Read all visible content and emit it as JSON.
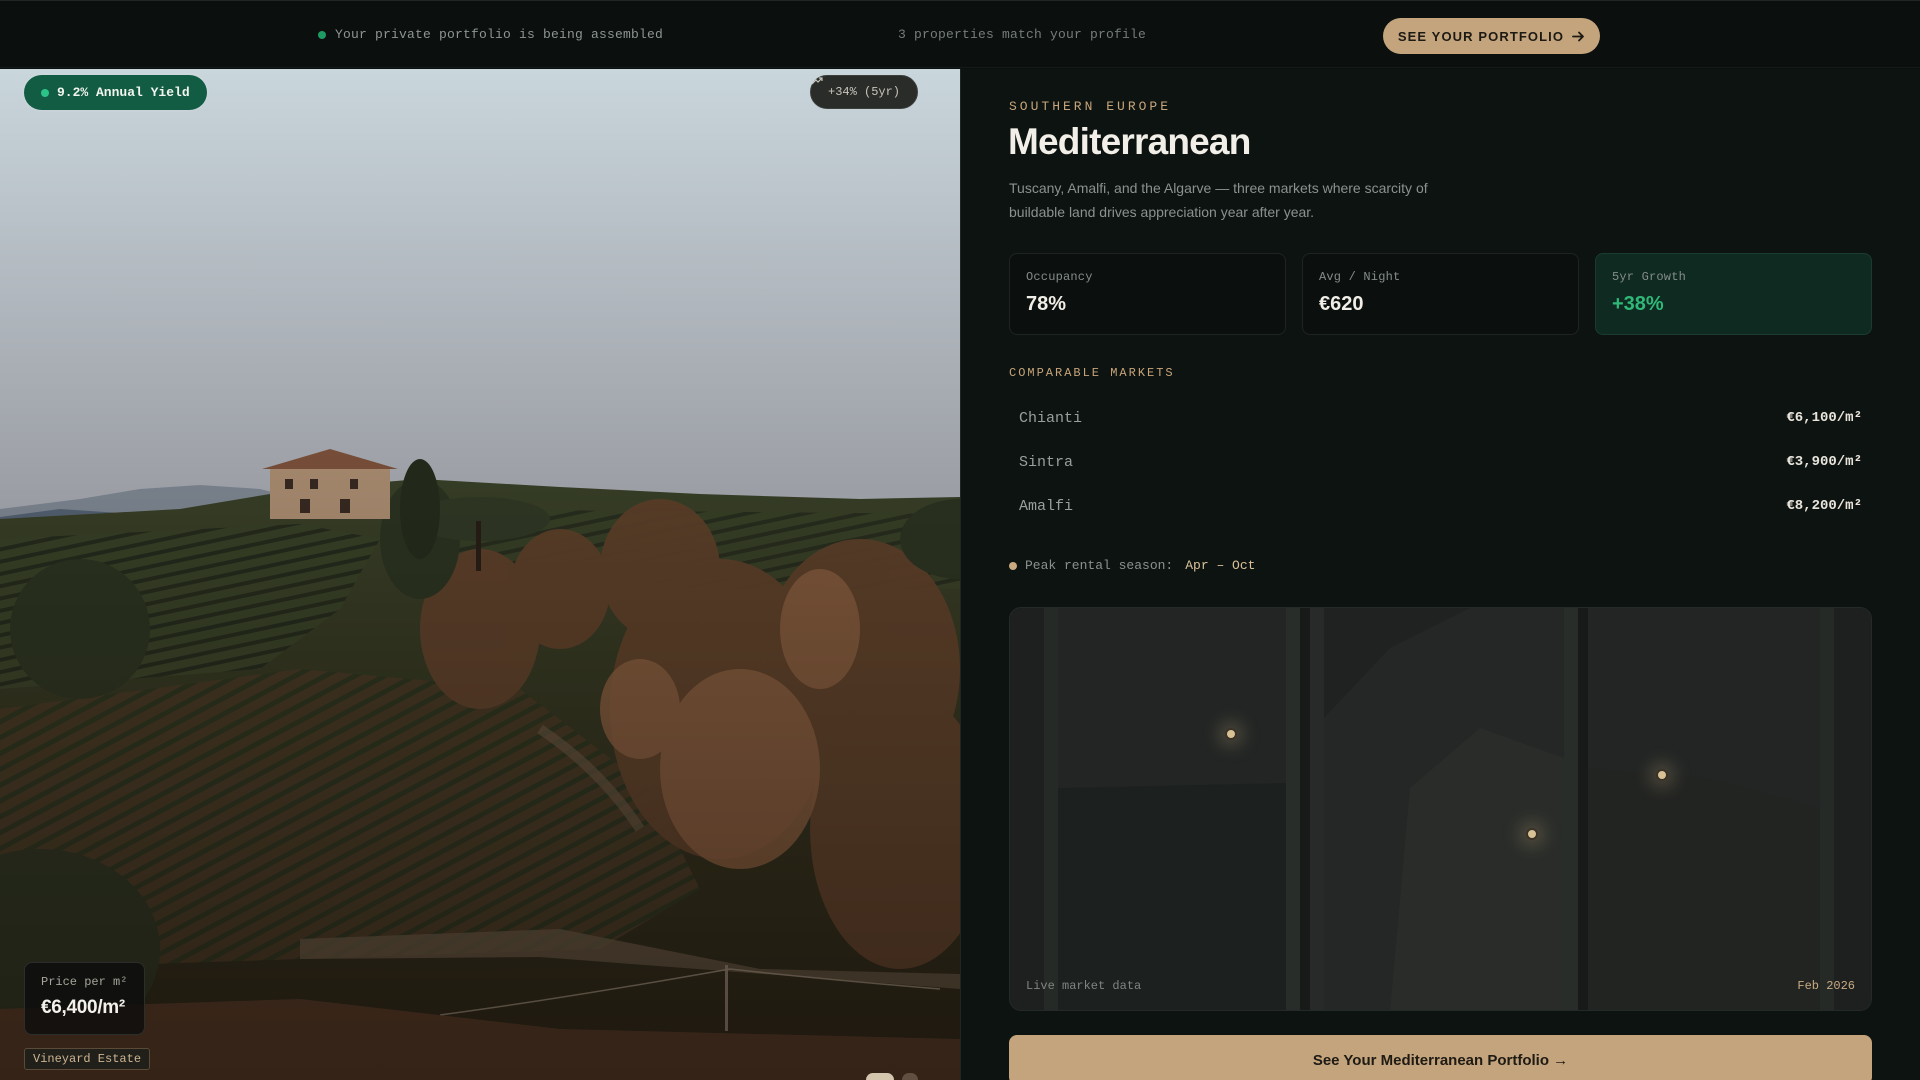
{
  "topbar": {
    "status_text": "Your private portfolio is being assembled",
    "match_text": "3 properties match your profile",
    "cta_label": "SEE YOUR PORTFOLIO",
    "cta_icon": "arrow-right-icon"
  },
  "hero": {
    "yield_label": "9.2% Annual Yield",
    "growth_label": "+34% (5yr)",
    "growth_icon": "trend-up-icon",
    "price_label": "Price per m²",
    "price_value": "€6,400/m²",
    "estate_tag": "Vineyard Estate"
  },
  "panel": {
    "region": "SOUTHERN EUROPE",
    "title": "Mediterranean",
    "description": "Tuscany, Amalfi, and the Algarve — three markets where scarcity of buildable land drives appreciation year after year.",
    "stats": [
      {
        "label": "Occupancy",
        "value": "78%"
      },
      {
        "label": "Avg / Night",
        "value": "€620"
      },
      {
        "label": "5yr Growth",
        "value": "+38%"
      }
    ],
    "comparables_heading": "COMPARABLE MARKETS",
    "comparables": [
      {
        "name": "Chianti",
        "price": "€6,100/m²"
      },
      {
        "name": "Sintra",
        "price": "€3,900/m²"
      },
      {
        "name": "Amalfi",
        "price": "€8,200/m²"
      }
    ],
    "season_label": "Peak rental season:",
    "season_value": "Apr – Oct",
    "map_live_label": "Live market data",
    "map_date": "Feb 2026",
    "bottom_cta": "See Your Mediterranean Portfolio →"
  },
  "colors": {
    "accent_gold": "#c4a47c",
    "accent_green": "#2fb878",
    "background": "#0d1311"
  }
}
